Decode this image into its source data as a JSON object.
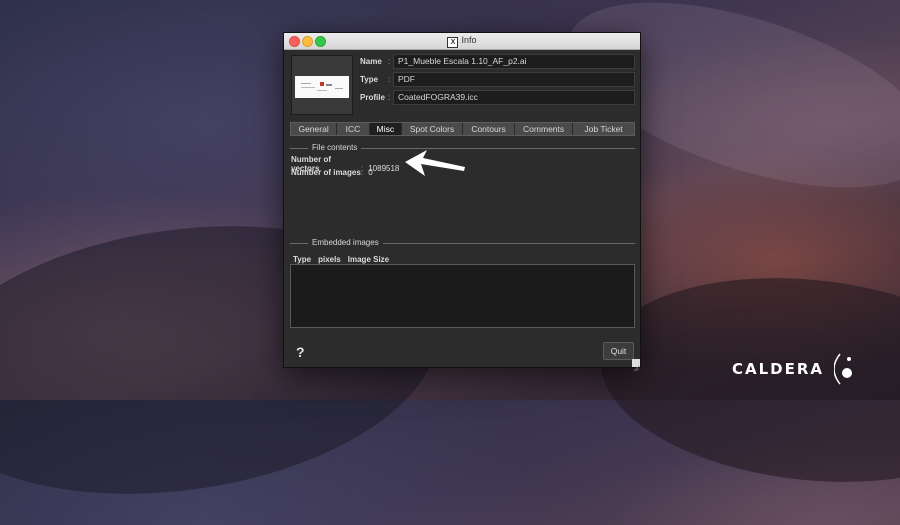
{
  "window": {
    "title": "Info",
    "icon": "x11-icon"
  },
  "fields": {
    "name_label": "Name",
    "name_value": "P1_Mueble Escala 1.10_AF_p2.ai",
    "type_label": "Type",
    "type_value": "PDF",
    "profile_label": "Profile",
    "profile_value": "CoatedFOGRA39.icc",
    "separator": ":"
  },
  "tabs": [
    {
      "label": "General",
      "active": false
    },
    {
      "label": "ICC",
      "active": false
    },
    {
      "label": "Misc",
      "active": true
    },
    {
      "label": "Spot Colors",
      "active": false
    },
    {
      "label": "Contours",
      "active": false
    },
    {
      "label": "Comments",
      "active": false
    },
    {
      "label": "Job Ticket",
      "active": false
    }
  ],
  "file_contents": {
    "heading": "File contents",
    "vectors_label": "Number of vectors",
    "vectors_value": "1089518",
    "images_label": "Number of images",
    "images_value": "0"
  },
  "embedded_images": {
    "heading": "Embedded images",
    "columns": [
      "Type",
      "pixels",
      "Image Size"
    ],
    "rows": []
  },
  "footer": {
    "help_label": "?",
    "quit_label": "Quit"
  },
  "brand": {
    "name": "CALDERA"
  },
  "colors": {
    "window_bg": "#2c2c2c",
    "active_tab": "#1f1f1f",
    "arrow": "#ffffff"
  }
}
